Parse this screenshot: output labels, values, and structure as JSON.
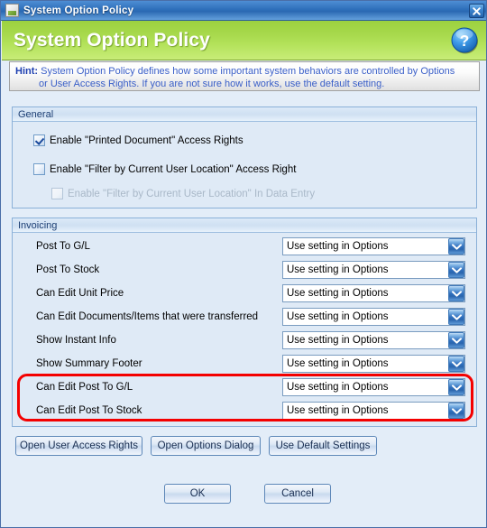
{
  "window": {
    "title": "System Option Policy",
    "icon": "document-policy-icon",
    "close_label": "Close",
    "close_icon": "close-icon"
  },
  "banner": {
    "title": "System Option Policy",
    "help_icon": "help-question-icon"
  },
  "hint": {
    "label": "Hint:",
    "line1": "System Option Policy defines how some important system behaviors are controlled by Options",
    "line2": "or User Access Rights. If you are not sure how it works, use the default setting."
  },
  "general": {
    "header": "General",
    "checkboxes": [
      {
        "label": "Enable \"Printed Document\" Access Rights",
        "checked": true,
        "disabled": false
      },
      {
        "label": "Enable \"Filter by Current User Location\" Access Right",
        "checked": false,
        "disabled": false
      },
      {
        "label": "Enable \"Filter by Current User Location\" In Data Entry",
        "checked": false,
        "disabled": true
      }
    ]
  },
  "invoicing": {
    "header": "Invoicing",
    "rows": [
      {
        "label": "Post To G/L",
        "value": "Use setting in Options",
        "highlighted": false
      },
      {
        "label": "Post To Stock",
        "value": "Use setting in Options",
        "highlighted": false
      },
      {
        "label": "Can Edit Unit Price",
        "value": "Use setting in Options",
        "highlighted": false
      },
      {
        "label": "Can Edit Documents/Items that were transferred",
        "value": "Use setting in Options",
        "highlighted": false
      },
      {
        "label": "Show Instant Info",
        "value": "Use setting in Options",
        "highlighted": false
      },
      {
        "label": "Show Summary Footer",
        "value": "Use setting in Options",
        "highlighted": false
      },
      {
        "label": "Can Edit Post To G/L",
        "value": "Use setting in Options",
        "highlighted": true
      },
      {
        "label": "Can Edit Post To Stock",
        "value": "Use setting in Options",
        "highlighted": true
      }
    ],
    "dropdown_icon": "chevron-down-icon"
  },
  "actions": {
    "open_user_access_rights": "Open User Access Rights",
    "open_options_dialog": "Open Options Dialog",
    "use_default_settings": "Use Default Settings",
    "ok": "OK",
    "cancel": "Cancel"
  },
  "colors": {
    "banner_green": "#a7d94c",
    "titlebar_blue": "#2e6fba",
    "dialog_background": "#e3edf8",
    "highlight_red": "#f40000",
    "hint_text": "#3a5fc8"
  }
}
